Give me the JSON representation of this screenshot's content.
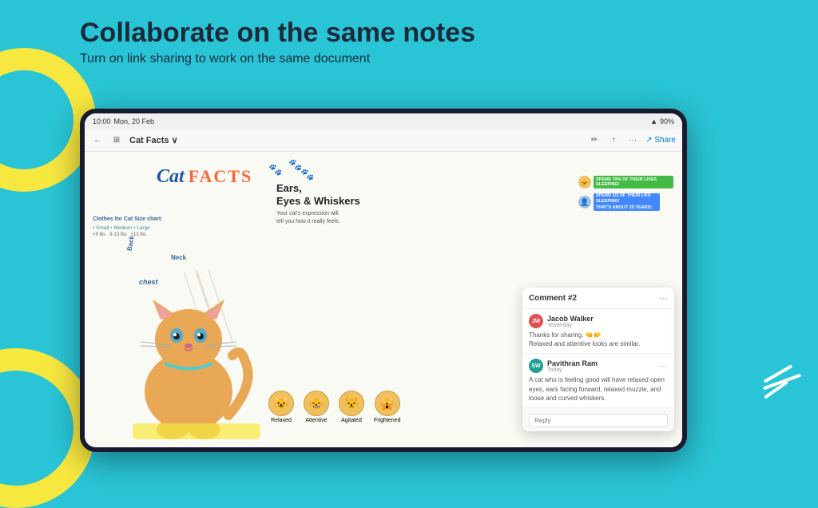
{
  "page": {
    "background_color": "#29c5d6"
  },
  "header": {
    "title": "Collaborate on the same notes",
    "subtitle": "Turn on link sharing to work on the same document"
  },
  "tablet": {
    "status_bar": {
      "time": "10:00",
      "date": "Mon, 20 Feb",
      "battery": "90%",
      "signal": "●●●"
    },
    "toolbar": {
      "back_icon": "←",
      "grid_icon": "⊞",
      "document_title": "Cat Facts ∨",
      "pen_icon": "✏",
      "export_icon": "↑",
      "more_icon": "···",
      "share_label": "↗ Share"
    }
  },
  "note": {
    "title_cat": "Cat",
    "title_facts": "FACTS",
    "size_chart": {
      "title": "Clothes for Cat Size chart:",
      "sizes": [
        "• Small • Medium • Large",
        "<9 lbs    9-13 lbs    >13 lbs"
      ]
    },
    "body_labels": [
      "Back",
      "Neck",
      "chest"
    ],
    "ears_title": "Ears,\nEyes & Whiskers",
    "ears_desc": "Your cat's expression will\ntell you how it really feels.",
    "cat_faces": [
      {
        "label": "Relaxed",
        "emoji": "😺"
      },
      {
        "label": "Attentive",
        "emoji": "😸"
      },
      {
        "label": "Agitated",
        "emoji": "😾"
      },
      {
        "label": "Frightened",
        "emoji": "🙀"
      }
    ],
    "stats": [
      {
        "label": "SPEND 70% OF THEIR LIVES SLEEPING!",
        "color": "green",
        "width": "70%"
      },
      {
        "label": "SPEND 1/3 OF THEIR LIFE SLEEPING!\nTHAT'S ABOUT 25 YEARS!",
        "color": "blue",
        "width": "55%"
      }
    ]
  },
  "comment_panel": {
    "title": "Comment #2",
    "more_icon": "···",
    "comments": [
      {
        "id": "jw",
        "initials": "JW",
        "avatar_color": "#e05050",
        "name": "Jacob Walker",
        "time": "Yesterday",
        "text": "Thanks for sharing. 🤜🤛\nRelaxed and attentive looks are similar.",
        "more_icon": ""
      },
      {
        "id": "pr",
        "initials": "SW",
        "avatar_color": "#20a090",
        "name": "Pavithran Ram",
        "time": "Today",
        "text": "A cat who is feeling good will have relaxed open eyes, ears facing forward, relaxed muzzle, and loose and curved whiskers.",
        "more_icon": "···"
      }
    ],
    "reply_placeholder": "Reply"
  }
}
